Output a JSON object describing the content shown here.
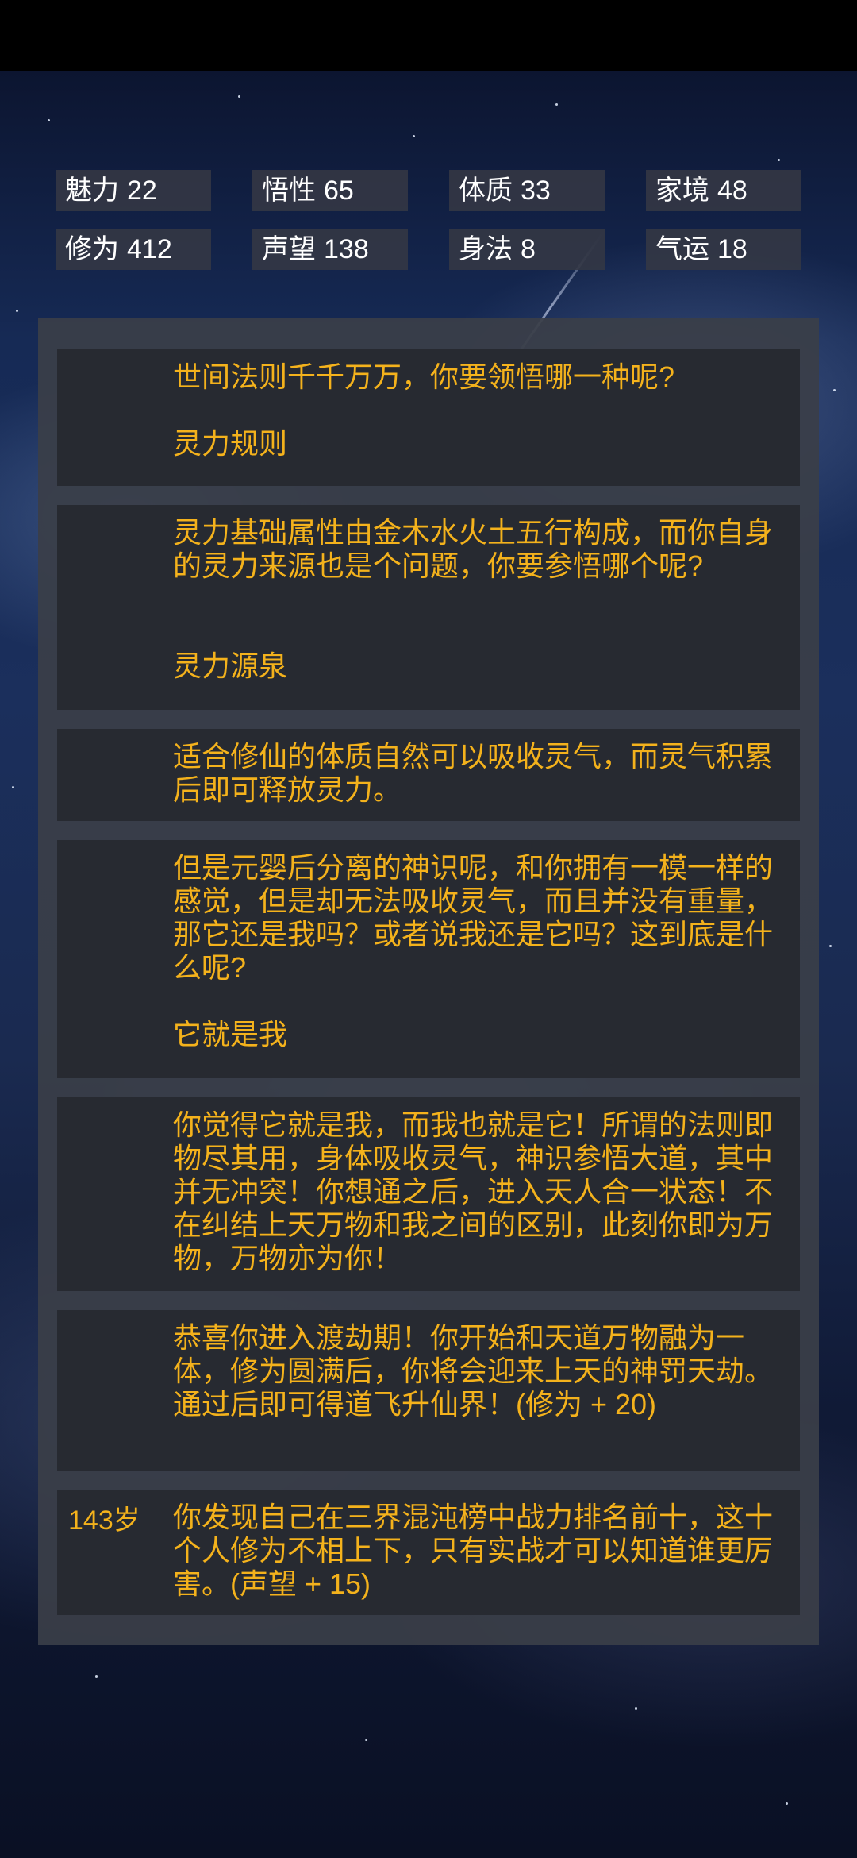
{
  "stats": [
    {
      "label": "魅力",
      "value": "22"
    },
    {
      "label": "悟性",
      "value": "65"
    },
    {
      "label": "体质",
      "value": "33"
    },
    {
      "label": "家境",
      "value": "48"
    },
    {
      "label": "修为",
      "value": "412"
    },
    {
      "label": "声望",
      "value": "138"
    },
    {
      "label": "身法",
      "value": "8"
    },
    {
      "label": "气运",
      "value": "18"
    }
  ],
  "entries": [
    {
      "age": "",
      "text": "世间法则千千万万，你要领悟哪一种呢?",
      "choice": "灵力规则"
    },
    {
      "age": "",
      "text": "灵力基础属性由金木水火土五行构成，而你自身的灵力来源也是个问题，你要参悟哪个呢?",
      "choice": "灵力源泉"
    },
    {
      "age": "",
      "text": "适合修仙的体质自然可以吸收灵气，而灵气积累后即可释放灵力。",
      "choice": ""
    },
    {
      "age": "",
      "text": "但是元婴后分离的神识呢，和你拥有一模一样的感觉，但是却无法吸收灵气，而且并没有重量，那它还是我吗？或者说我还是它吗？这到底是什么呢?",
      "choice": "它就是我"
    },
    {
      "age": "",
      "text": "你觉得它就是我，而我也就是它！所谓的法则即物尽其用，身体吸收灵气，神识参悟大道，其中并无冲突！你想通之后，进入天人合一状态！不在纠结上天万物和我之间的区别，此刻你即为万物，万物亦为你！",
      "choice": ""
    },
    {
      "age": "",
      "text": "恭喜你进入渡劫期！你开始和天道万物融为一体，修为圆满后，你将会迎来上天的神罚天劫。通过后即可得道飞升仙界！(修为 + 20)",
      "choice": ""
    },
    {
      "age": "143岁",
      "text": "你发现自己在三界混沌榜中战力排名前十，这十个人修为不相上下，只有实战才可以知道谁更厉害。(声望 + 15)",
      "choice": ""
    }
  ]
}
